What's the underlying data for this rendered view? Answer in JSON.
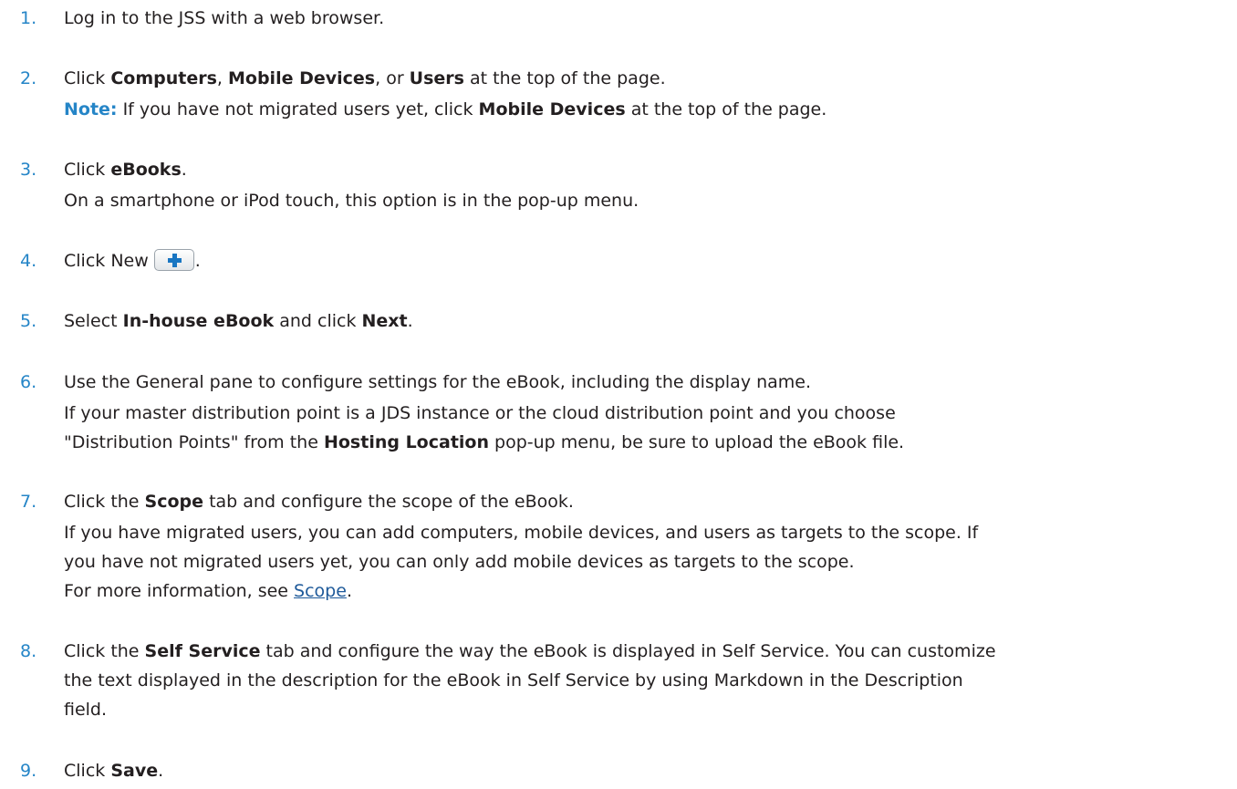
{
  "steps": [
    {
      "number": "1.",
      "text": "Log in to the JSS with a web browser."
    },
    {
      "number": "2.",
      "pre": "Click ",
      "b1": "Computers",
      "sep1": ", ",
      "b2": "Mobile Devices",
      "sep2": ", or ",
      "b3": "Users",
      "post": " at the top of the page.",
      "note_label": "Note:",
      "note_pre": " If you have not migrated users yet, click ",
      "note_bold": "Mobile Devices",
      "note_post": " at the top of the page."
    },
    {
      "number": "3.",
      "pre": "Click ",
      "bold": "eBooks",
      "post": ".",
      "detail": "On a smartphone or iPod touch, this option is in the pop-up menu."
    },
    {
      "number": "4.",
      "pre": "Click New",
      "post": ".",
      "icon": "plus-icon"
    },
    {
      "number": "5.",
      "pre": "Select ",
      "b1": "In-house eBook",
      "mid": " and click ",
      "b2": "Next",
      "post": "."
    },
    {
      "number": "6.",
      "text": "Use the General pane to configure settings for the eBook, including the display name.",
      "detail_line1": "If your master distribution point is a JDS instance or the cloud distribution point and you choose",
      "detail_pre": "\"Distribution Points\" from the ",
      "detail_bold": "Hosting Location",
      "detail_post": " pop-up menu, be sure to upload the eBook file."
    },
    {
      "number": "7.",
      "pre": "Click the ",
      "bold": "Scope",
      "post": " tab and configure the scope of the eBook.",
      "detail_line1": "If you have migrated users, you can add computers, mobile devices, and users as targets to the scope. If",
      "detail_line2": "you have not migrated users yet, you can only add mobile devices as targets to the scope.",
      "more_pre": "For more information, see ",
      "more_link": "Scope",
      "more_post": "."
    },
    {
      "number": "8.",
      "pre": "Click the ",
      "bold": "Self Service",
      "post": " tab and configure the way the eBook is displayed in Self Service. You can customize",
      "line2": "the text displayed in the description for the eBook in Self Service by using Markdown in the Description",
      "line3": "field."
    },
    {
      "number": "9.",
      "pre": "Click ",
      "bold": "Save",
      "post": "."
    }
  ]
}
